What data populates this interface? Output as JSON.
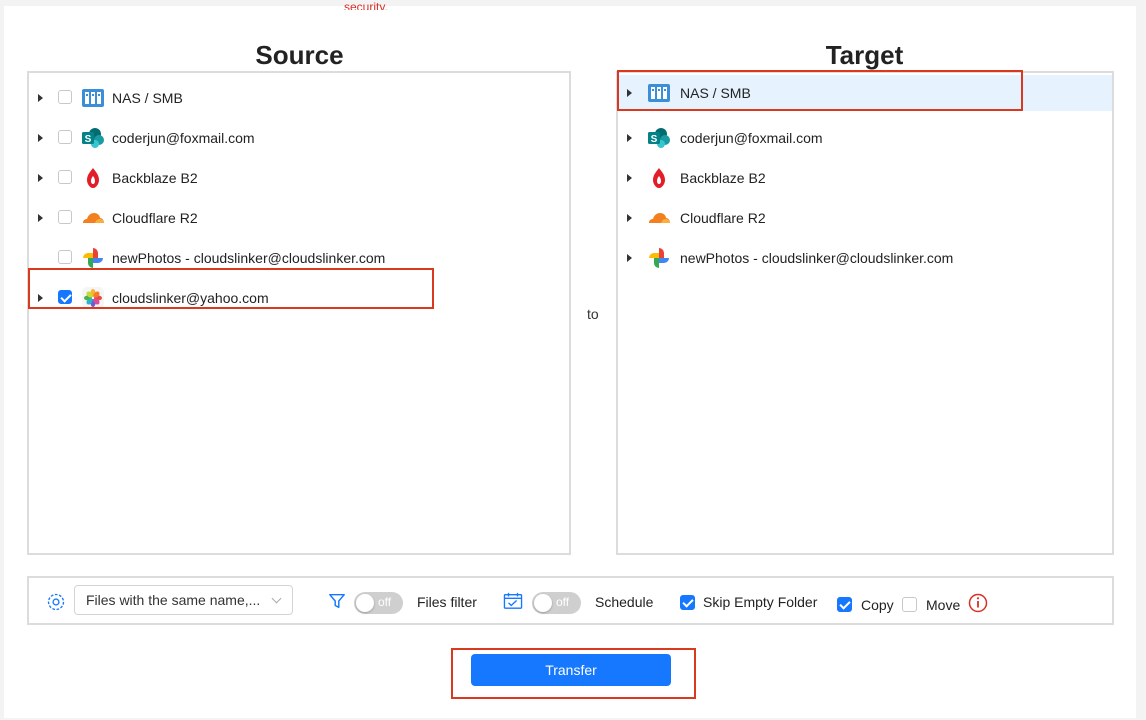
{
  "top_note": "security.",
  "source": {
    "title": "Source",
    "items": [
      {
        "label": "NAS / SMB",
        "icon": "nas-icon",
        "expandable": true,
        "checked": false
      },
      {
        "label": "coderjun@foxmail.com",
        "icon": "sharepoint-icon",
        "expandable": true,
        "checked": false
      },
      {
        "label": "Backblaze B2",
        "icon": "backblaze-icon",
        "expandable": true,
        "checked": false
      },
      {
        "label": "Cloudflare R2",
        "icon": "cloudflare-icon",
        "expandable": true,
        "checked": false
      },
      {
        "label": "newPhotos - cloudslinker@cloudslinker.com",
        "icon": "google-photos-icon",
        "expandable": false,
        "checked": false
      },
      {
        "label": "cloudslinker@yahoo.com",
        "icon": "apple-photos-icon",
        "expandable": true,
        "checked": true
      }
    ]
  },
  "connector": "to",
  "target": {
    "title": "Target",
    "selected_index": 0,
    "items": [
      {
        "label": "NAS / SMB",
        "icon": "nas-icon"
      },
      {
        "label": "coderjun@foxmail.com",
        "icon": "sharepoint-icon"
      },
      {
        "label": "Backblaze B2",
        "icon": "backblaze-icon"
      },
      {
        "label": "Cloudflare R2",
        "icon": "cloudflare-icon"
      },
      {
        "label": "newPhotos - cloudslinker@cloudslinker.com",
        "icon": "google-photos-icon"
      }
    ]
  },
  "options": {
    "conflict_select": "Files with the same name,...",
    "files_filter": {
      "state": "off",
      "label": "Files filter"
    },
    "schedule": {
      "state": "off",
      "label": "Schedule"
    },
    "skip_empty_folder": {
      "label": "Skip Empty Folder",
      "checked": true
    },
    "copy": {
      "label": "Copy",
      "checked": true
    },
    "move": {
      "label": "Move",
      "checked": false
    }
  },
  "transfer_label": "Transfer",
  "colors": {
    "accent": "#1677ff",
    "highlight_border": "#d93a1f",
    "selected_row": "#e6f2fd",
    "info_icon": "#d93025"
  }
}
